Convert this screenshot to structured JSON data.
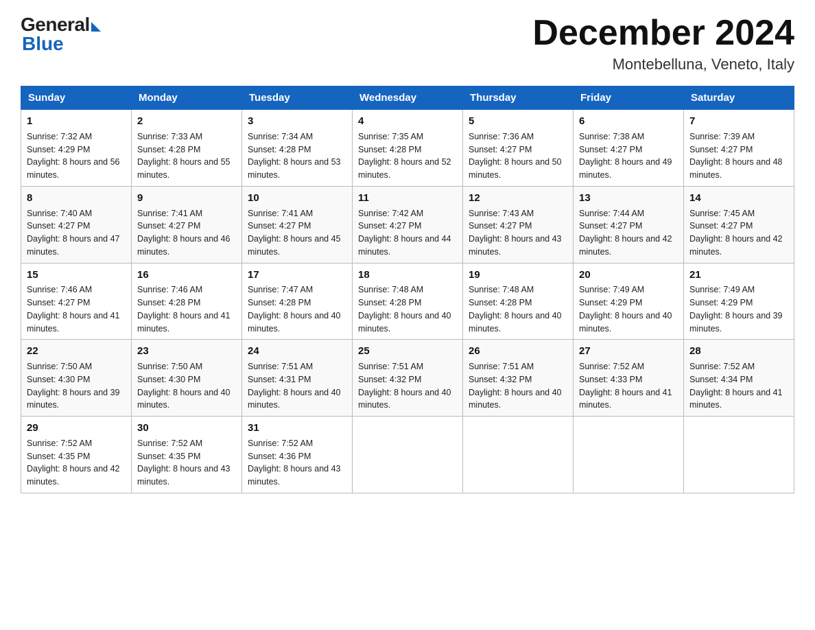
{
  "header": {
    "logo_general": "General",
    "logo_blue": "Blue",
    "month_title": "December 2024",
    "location": "Montebelluna, Veneto, Italy"
  },
  "days_of_week": [
    "Sunday",
    "Monday",
    "Tuesday",
    "Wednesday",
    "Thursday",
    "Friday",
    "Saturday"
  ],
  "weeks": [
    [
      {
        "day": "1",
        "sunrise": "7:32 AM",
        "sunset": "4:29 PM",
        "daylight": "8 hours and 56 minutes."
      },
      {
        "day": "2",
        "sunrise": "7:33 AM",
        "sunset": "4:28 PM",
        "daylight": "8 hours and 55 minutes."
      },
      {
        "day": "3",
        "sunrise": "7:34 AM",
        "sunset": "4:28 PM",
        "daylight": "8 hours and 53 minutes."
      },
      {
        "day": "4",
        "sunrise": "7:35 AM",
        "sunset": "4:28 PM",
        "daylight": "8 hours and 52 minutes."
      },
      {
        "day": "5",
        "sunrise": "7:36 AM",
        "sunset": "4:27 PM",
        "daylight": "8 hours and 50 minutes."
      },
      {
        "day": "6",
        "sunrise": "7:38 AM",
        "sunset": "4:27 PM",
        "daylight": "8 hours and 49 minutes."
      },
      {
        "day": "7",
        "sunrise": "7:39 AM",
        "sunset": "4:27 PM",
        "daylight": "8 hours and 48 minutes."
      }
    ],
    [
      {
        "day": "8",
        "sunrise": "7:40 AM",
        "sunset": "4:27 PM",
        "daylight": "8 hours and 47 minutes."
      },
      {
        "day": "9",
        "sunrise": "7:41 AM",
        "sunset": "4:27 PM",
        "daylight": "8 hours and 46 minutes."
      },
      {
        "day": "10",
        "sunrise": "7:41 AM",
        "sunset": "4:27 PM",
        "daylight": "8 hours and 45 minutes."
      },
      {
        "day": "11",
        "sunrise": "7:42 AM",
        "sunset": "4:27 PM",
        "daylight": "8 hours and 44 minutes."
      },
      {
        "day": "12",
        "sunrise": "7:43 AM",
        "sunset": "4:27 PM",
        "daylight": "8 hours and 43 minutes."
      },
      {
        "day": "13",
        "sunrise": "7:44 AM",
        "sunset": "4:27 PM",
        "daylight": "8 hours and 42 minutes."
      },
      {
        "day": "14",
        "sunrise": "7:45 AM",
        "sunset": "4:27 PM",
        "daylight": "8 hours and 42 minutes."
      }
    ],
    [
      {
        "day": "15",
        "sunrise": "7:46 AM",
        "sunset": "4:27 PM",
        "daylight": "8 hours and 41 minutes."
      },
      {
        "day": "16",
        "sunrise": "7:46 AM",
        "sunset": "4:28 PM",
        "daylight": "8 hours and 41 minutes."
      },
      {
        "day": "17",
        "sunrise": "7:47 AM",
        "sunset": "4:28 PM",
        "daylight": "8 hours and 40 minutes."
      },
      {
        "day": "18",
        "sunrise": "7:48 AM",
        "sunset": "4:28 PM",
        "daylight": "8 hours and 40 minutes."
      },
      {
        "day": "19",
        "sunrise": "7:48 AM",
        "sunset": "4:28 PM",
        "daylight": "8 hours and 40 minutes."
      },
      {
        "day": "20",
        "sunrise": "7:49 AM",
        "sunset": "4:29 PM",
        "daylight": "8 hours and 40 minutes."
      },
      {
        "day": "21",
        "sunrise": "7:49 AM",
        "sunset": "4:29 PM",
        "daylight": "8 hours and 39 minutes."
      }
    ],
    [
      {
        "day": "22",
        "sunrise": "7:50 AM",
        "sunset": "4:30 PM",
        "daylight": "8 hours and 39 minutes."
      },
      {
        "day": "23",
        "sunrise": "7:50 AM",
        "sunset": "4:30 PM",
        "daylight": "8 hours and 40 minutes."
      },
      {
        "day": "24",
        "sunrise": "7:51 AM",
        "sunset": "4:31 PM",
        "daylight": "8 hours and 40 minutes."
      },
      {
        "day": "25",
        "sunrise": "7:51 AM",
        "sunset": "4:32 PM",
        "daylight": "8 hours and 40 minutes."
      },
      {
        "day": "26",
        "sunrise": "7:51 AM",
        "sunset": "4:32 PM",
        "daylight": "8 hours and 40 minutes."
      },
      {
        "day": "27",
        "sunrise": "7:52 AM",
        "sunset": "4:33 PM",
        "daylight": "8 hours and 41 minutes."
      },
      {
        "day": "28",
        "sunrise": "7:52 AM",
        "sunset": "4:34 PM",
        "daylight": "8 hours and 41 minutes."
      }
    ],
    [
      {
        "day": "29",
        "sunrise": "7:52 AM",
        "sunset": "4:35 PM",
        "daylight": "8 hours and 42 minutes."
      },
      {
        "day": "30",
        "sunrise": "7:52 AM",
        "sunset": "4:35 PM",
        "daylight": "8 hours and 43 minutes."
      },
      {
        "day": "31",
        "sunrise": "7:52 AM",
        "sunset": "4:36 PM",
        "daylight": "8 hours and 43 minutes."
      },
      null,
      null,
      null,
      null
    ]
  ]
}
